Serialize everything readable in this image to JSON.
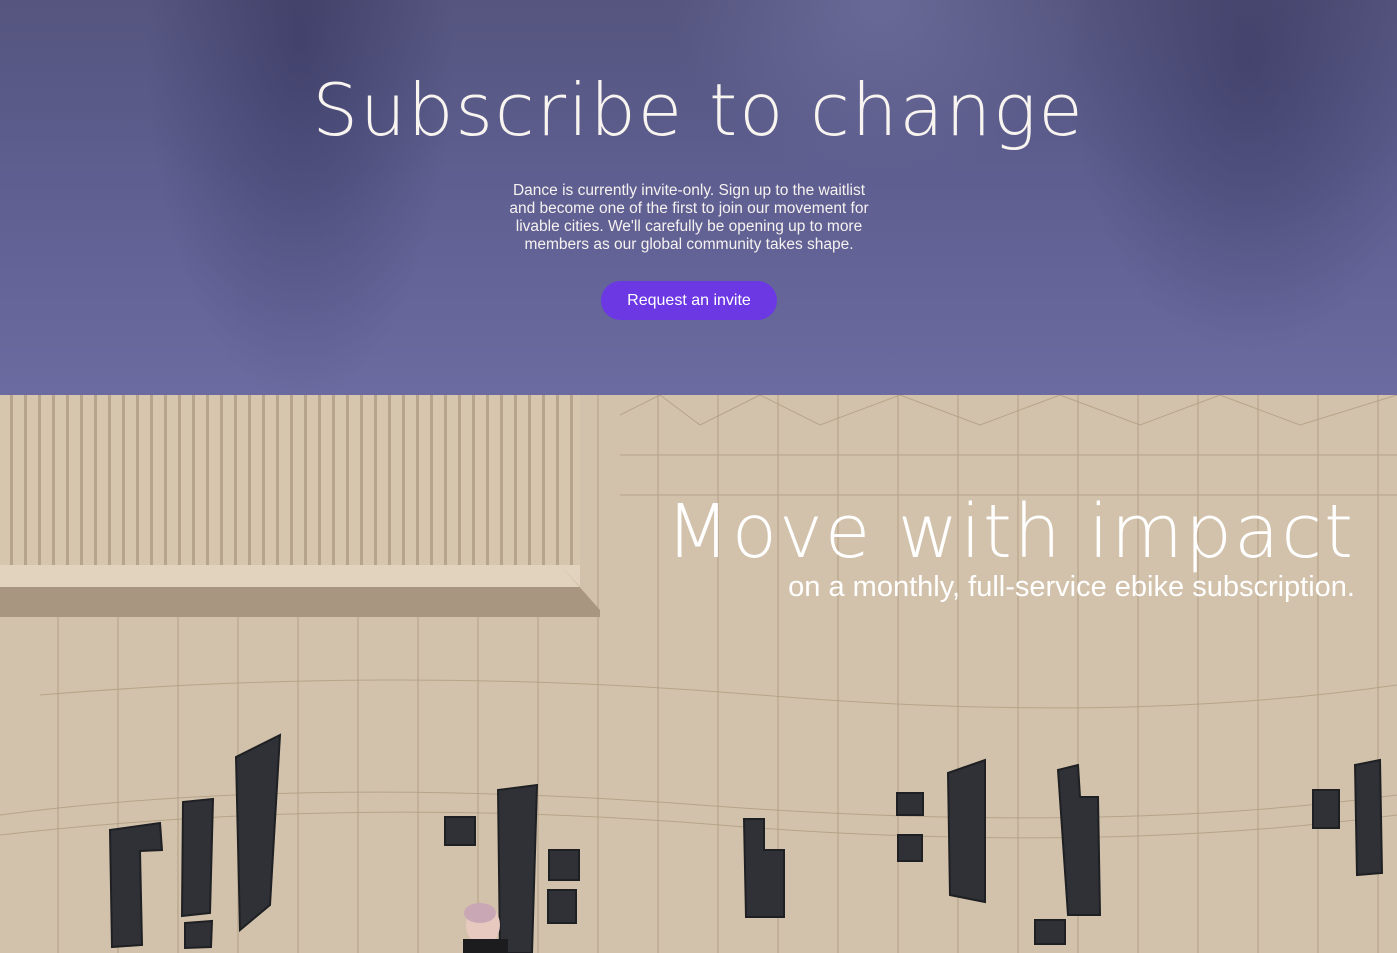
{
  "hero": {
    "title": "Subscribe to change",
    "description": "Dance is currently invite-only. Sign up to the waitlist and become one of the first to join our movement for livable cities. We'll carefully be opening up to more members as our global community takes shape.",
    "button_label": "Request an invite",
    "button_color": "#6b38e4",
    "background_color": "#5e5e90"
  },
  "impact": {
    "title": "Move with impact",
    "subtitle": "on a monthly, full-service ebike subscription."
  }
}
